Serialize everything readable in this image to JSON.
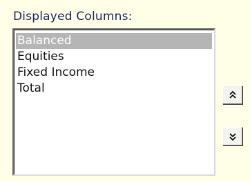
{
  "panel": {
    "title": "Displayed Columns:",
    "columns": [
      {
        "label": "Balanced",
        "selected": true
      },
      {
        "label": "Equities",
        "selected": false
      },
      {
        "label": "Fixed Income",
        "selected": false
      },
      {
        "label": "Total",
        "selected": false
      }
    ],
    "buttons": {
      "move_up_icon": "double-chevron-up-icon",
      "move_down_icon": "double-chevron-down-icon"
    }
  },
  "colors": {
    "background": "#FFFFE8",
    "title_text": "#17225E",
    "selected_row": "#B5B5B5"
  }
}
